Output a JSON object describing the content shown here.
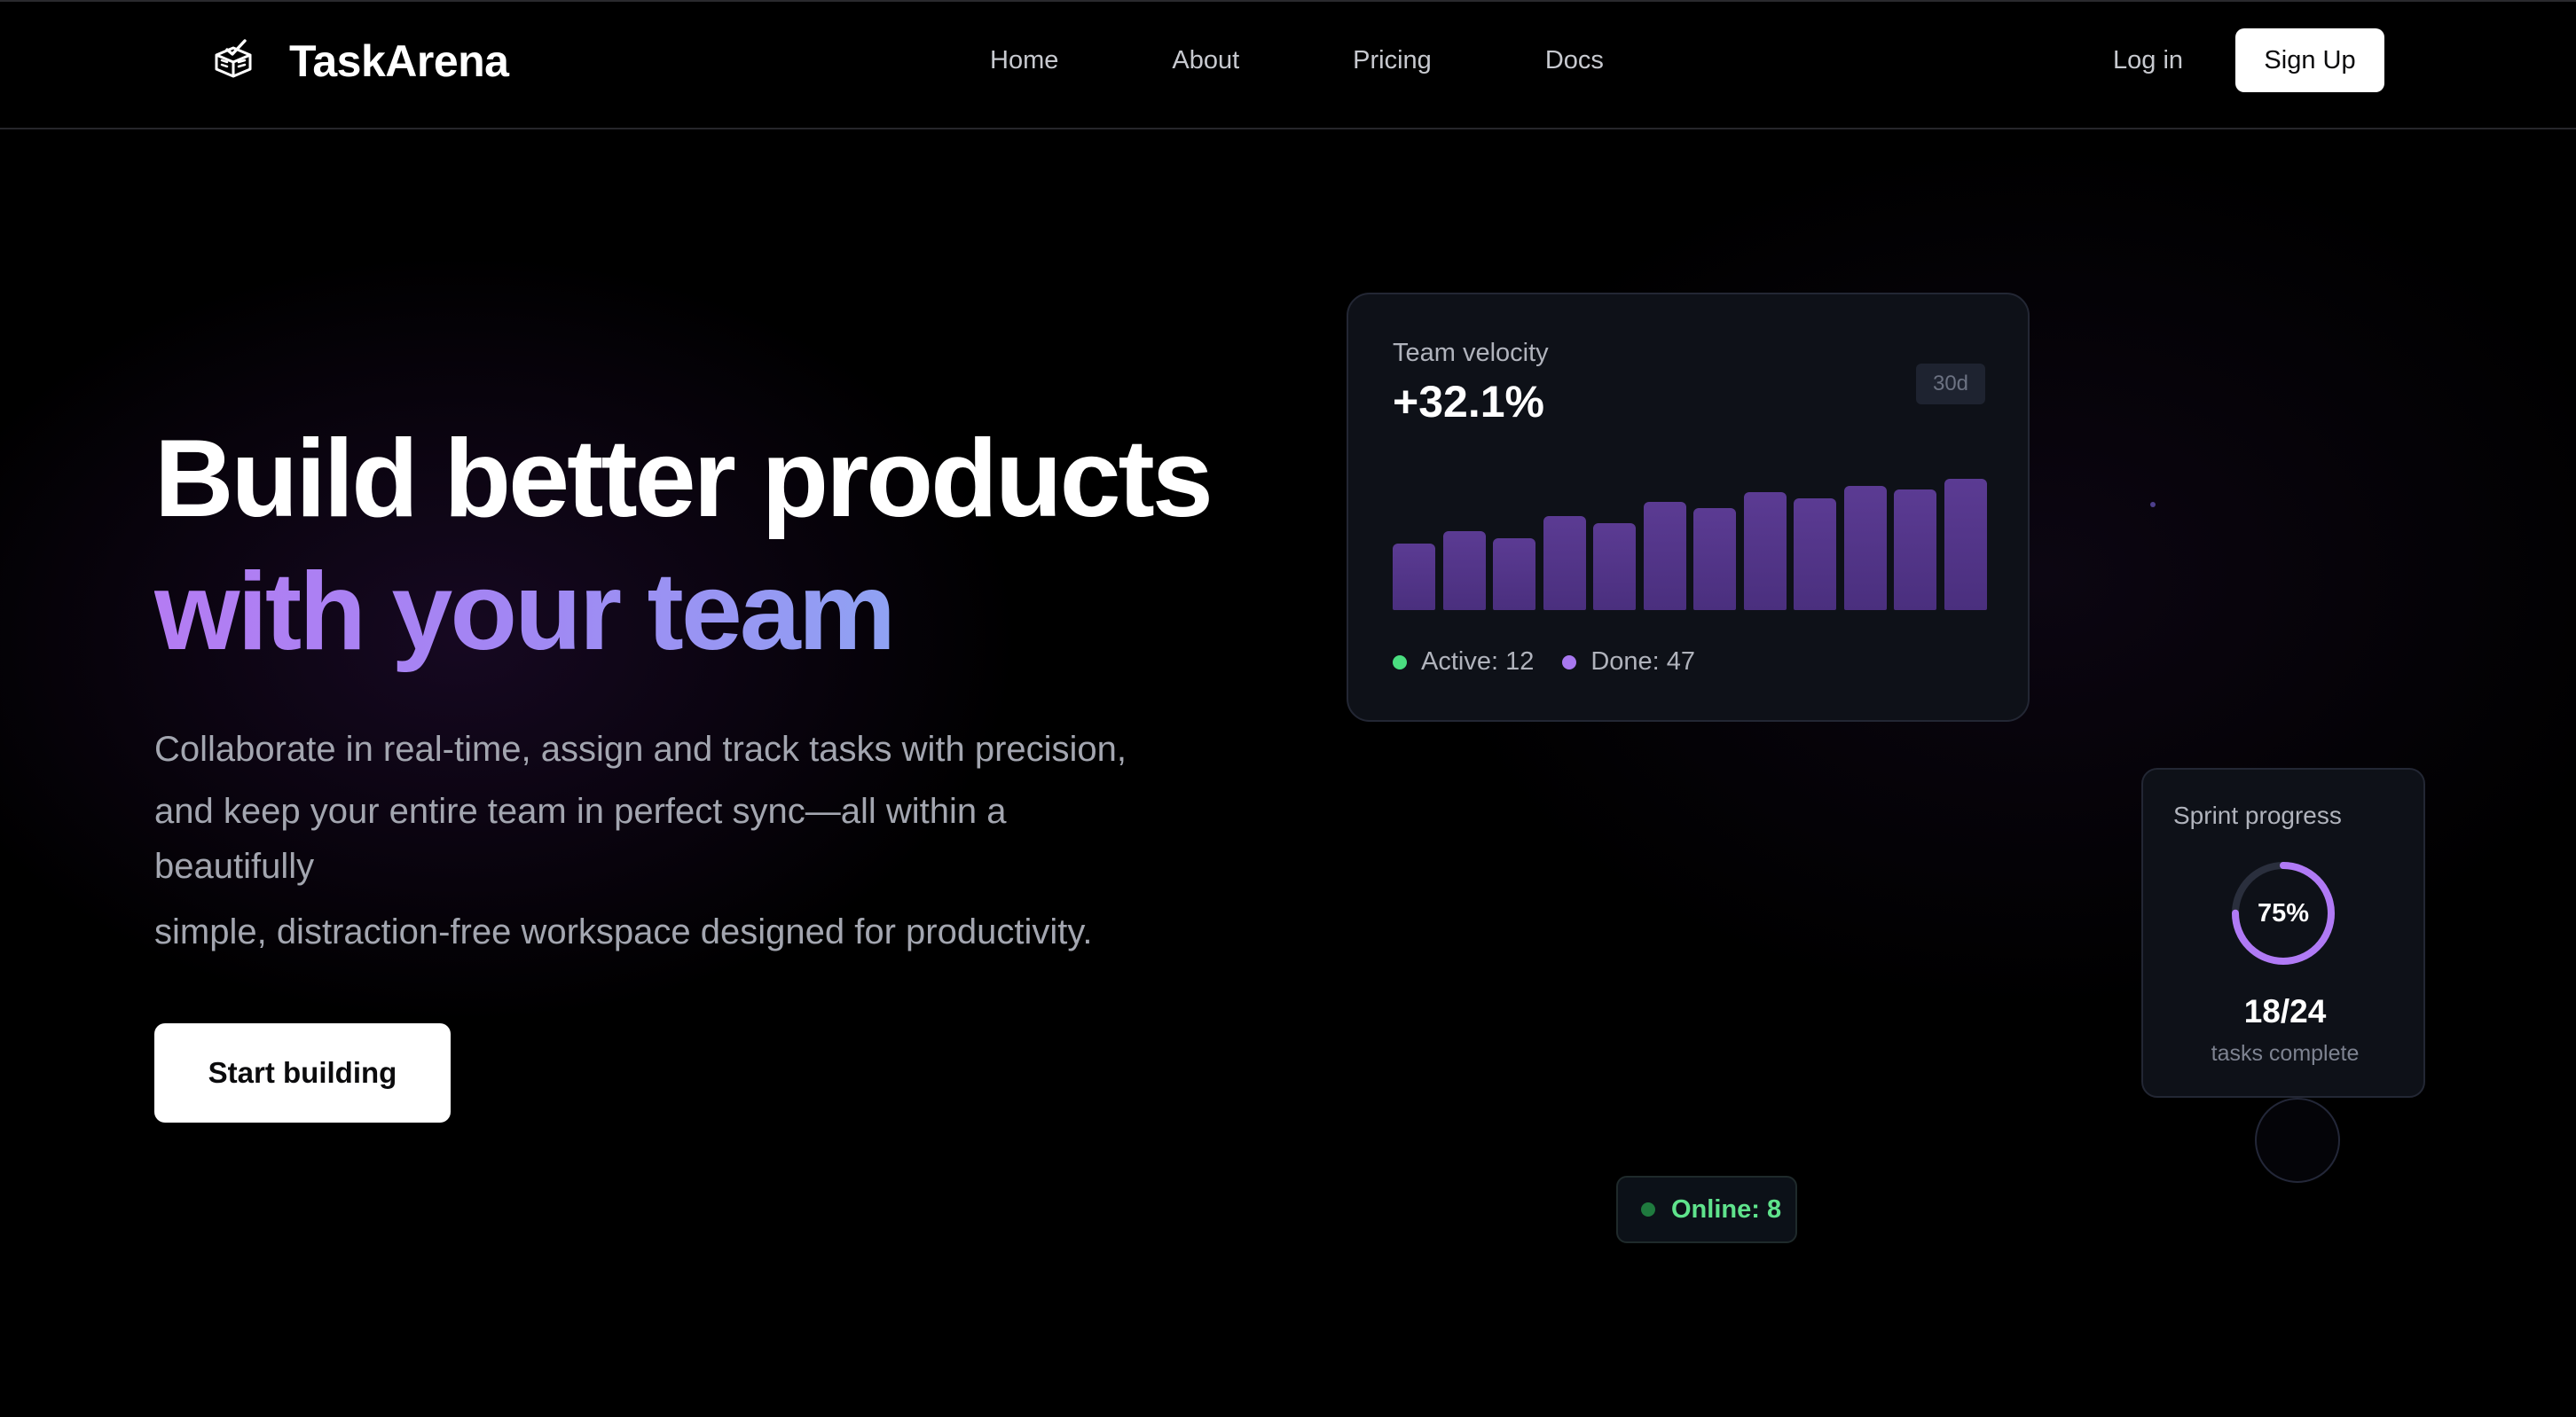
{
  "nav": {
    "brand": "TaskArena",
    "links": [
      "Home",
      "About",
      "Pricing",
      "Docs"
    ],
    "login_label": "Log in",
    "signup_label": "Sign Up"
  },
  "hero": {
    "headline_line1": "Build better products",
    "headline_line2": "with your team",
    "description_lines": [
      "Collaborate in real-time, assign and track tasks with precision,",
      "and keep your entire team in perfect sync—all within a",
      "beautifully",
      "simple, distraction-free workspace designed for productivity."
    ],
    "cta_label": "Start building"
  },
  "velocity_card": {
    "title": "Team velocity",
    "value": "+32.1%",
    "badge": "30d",
    "bar_levels": [
      0.48,
      0.57,
      0.52,
      0.68,
      0.63,
      0.78,
      0.74,
      0.85,
      0.81,
      0.9,
      0.87,
      0.95
    ],
    "legend": [
      {
        "label": "Active: 12",
        "color": "#4ade80"
      },
      {
        "label": "Done: 47",
        "color": "#a878f0"
      }
    ]
  },
  "sprint_card": {
    "title": "Sprint progress",
    "percent_label": "75%",
    "progress": 0.75,
    "count": "18/24",
    "subtitle": "tasks complete"
  },
  "online_pill": {
    "label": "Online: 8"
  },
  "colors": {
    "accent_purple": "#a878f0",
    "accent_green": "#4ade80",
    "background": "#000000"
  }
}
